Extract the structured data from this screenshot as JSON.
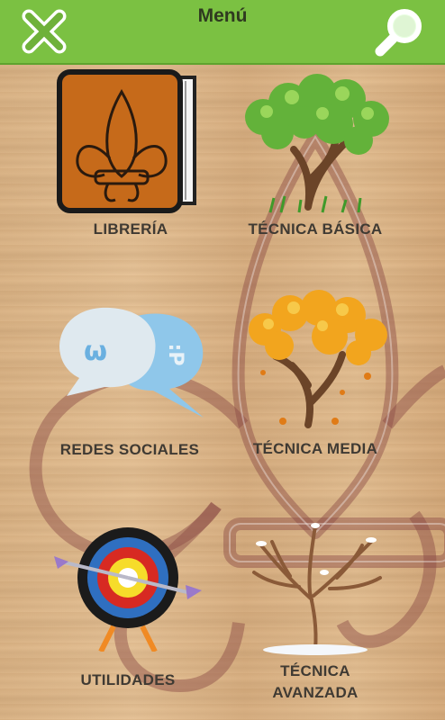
{
  "header": {
    "title": "Menú",
    "close_icon": "close-icon",
    "search_icon": "search-icon",
    "bar_color": "#7bc142"
  },
  "menu": {
    "libreria": "LIBRERÍA",
    "tecnica_basica": "TÉCNICA BÁSICA",
    "redes_sociales": "REDES SOCIALES",
    "tecnica_media": "TÉCNICA MEDIA",
    "utilidades": "UTILIDADES",
    "tecnica_avanzada_line1": "TÉCNICA",
    "tecnica_avanzada_line2": "AVANZADA"
  },
  "icons": {
    "libreria": "book-icon",
    "tecnica_basica": "green-tree-icon",
    "redes_sociales": "chat-bubbles-icon",
    "tecnica_media": "autumn-tree-icon",
    "utilidades": "target-icon",
    "tecnica_avanzada": "winter-tree-icon"
  },
  "decoration": {
    "emoticon_1": "ω",
    "emoticon_2": ":P"
  }
}
